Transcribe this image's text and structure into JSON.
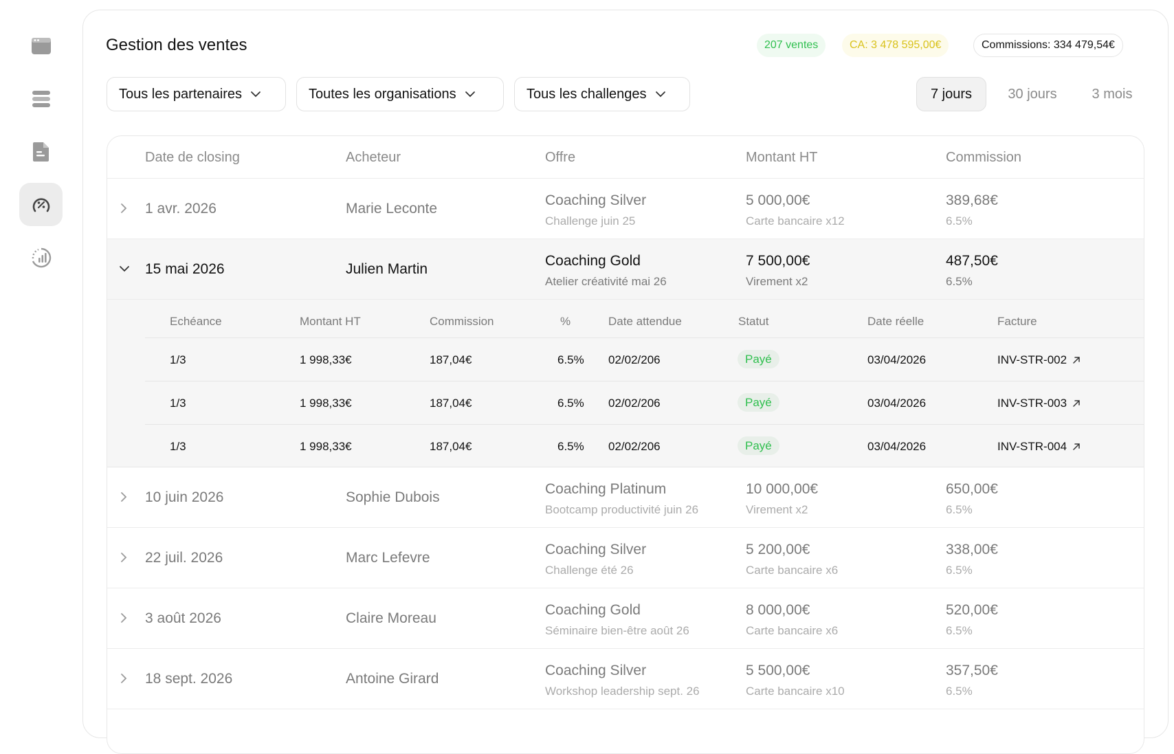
{
  "sidebar": {
    "items": [
      {
        "icon": "browser-window-icon",
        "active": false
      },
      {
        "icon": "database-stack-icon",
        "active": false
      },
      {
        "icon": "document-icon",
        "active": false
      },
      {
        "icon": "discount-gauge-icon",
        "active": true
      },
      {
        "icon": "analytics-chart-icon",
        "active": false
      }
    ]
  },
  "header": {
    "title": "Gestion des ventes",
    "badges": {
      "sales": "207 ventes",
      "revenue": "CA: 3 478 595,00€",
      "commissions": "Commissions: 334 479,54€"
    },
    "colors": {
      "green": "#2fbf4e",
      "yellow": "#d9c21a"
    }
  },
  "filters": {
    "partners": "Tous les partenaires",
    "organisations": "Toutes les organisations",
    "challenges": "Tous les challenges"
  },
  "periods": {
    "options": [
      "7 jours",
      "30 jours",
      "3 mois"
    ],
    "selected": "7 jours"
  },
  "table": {
    "columns": [
      "Date de closing",
      "Acheteur",
      "Offre",
      "Montant HT",
      "Commission"
    ],
    "rows": [
      {
        "date": "1 avr. 2026",
        "buyer": "Marie Leconte",
        "offer": "Coaching Silver",
        "event": "Challenge juin 25",
        "amount": "5 000,00€",
        "payment": "Carte bancaire x12",
        "commission": "389,68€",
        "rate": "6.5%",
        "expanded": false
      },
      {
        "date": "15 mai 2026",
        "buyer": "Julien Martin",
        "offer": "Coaching Gold",
        "event": "Atelier créativité mai 26",
        "amount": "7 500,00€",
        "payment": "Virement x2",
        "commission": "487,50€",
        "rate": "6.5%",
        "expanded": true
      },
      {
        "date": "10 juin 2026",
        "buyer": "Sophie Dubois",
        "offer": "Coaching Platinum",
        "event": "Bootcamp productivité juin 26",
        "amount": "10 000,00€",
        "payment": "Virement x2",
        "commission": "650,00€",
        "rate": "6.5%",
        "expanded": false
      },
      {
        "date": "22 juil. 2026",
        "buyer": "Marc Lefevre",
        "offer": "Coaching Silver",
        "event": "Challenge été 26",
        "amount": "5 200,00€",
        "payment": "Carte bancaire x6",
        "commission": "338,00€",
        "rate": "6.5%",
        "expanded": false
      },
      {
        "date": "3 août 2026",
        "buyer": "Claire Moreau",
        "offer": "Coaching Gold",
        "event": "Séminaire bien-être août 26",
        "amount": "8 000,00€",
        "payment": "Carte bancaire x6",
        "commission": "520,00€",
        "rate": "6.5%",
        "expanded": false
      },
      {
        "date": "18 sept. 2026",
        "buyer": "Antoine Girard",
        "offer": "Coaching Silver",
        "event": "Workshop leadership sept. 26",
        "amount": "5 500,00€",
        "payment": "Carte bancaire x10",
        "commission": "357,50€",
        "rate": "6.5%",
        "expanded": false
      }
    ],
    "installments": {
      "columns": [
        "Echéance",
        "Montant HT",
        "Commission",
        "%",
        "Date attendue",
        "Statut",
        "Date réelle",
        "Facture"
      ],
      "rows": [
        {
          "term": "1/3",
          "amount": "1 998,33€",
          "commission": "187,04€",
          "pct": "6.5%",
          "expected": "02/02/206",
          "status": "Payé",
          "actual": "03/04/2026",
          "invoice": "INV-STR-002"
        },
        {
          "term": "1/3",
          "amount": "1 998,33€",
          "commission": "187,04€",
          "pct": "6.5%",
          "expected": "02/02/206",
          "status": "Payé",
          "actual": "03/04/2026",
          "invoice": "INV-STR-003"
        },
        {
          "term": "1/3",
          "amount": "1 998,33€",
          "commission": "187,04€",
          "pct": "6.5%",
          "expected": "02/02/206",
          "status": "Payé",
          "actual": "03/04/2026",
          "invoice": "INV-STR-004"
        }
      ]
    }
  }
}
